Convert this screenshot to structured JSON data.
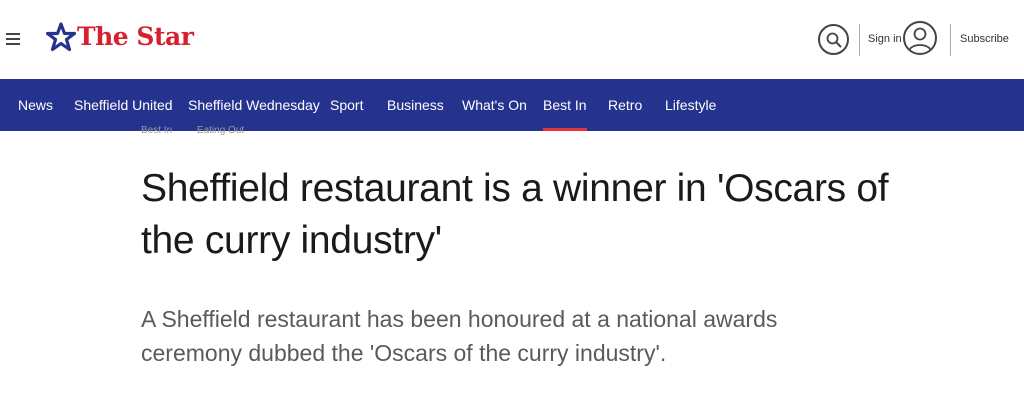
{
  "header": {
    "brand": "The Star",
    "signin_label": "Sign in",
    "subscribe_label": "Subscribe"
  },
  "nav": {
    "items": [
      {
        "label": "News"
      },
      {
        "label": "Sheffield United"
      },
      {
        "label": "Sheffield Wednesday"
      },
      {
        "label": "Sport"
      },
      {
        "label": "Business"
      },
      {
        "label": "What's On"
      },
      {
        "label": "Best In",
        "active": true
      },
      {
        "label": "Retro"
      },
      {
        "label": "Lifestyle"
      }
    ]
  },
  "breadcrumb": {
    "items": [
      "Best In",
      "Eating Out"
    ]
  },
  "article": {
    "headline": "Sheffield restaurant is a winner in 'Oscars of the curry industry'",
    "standfirst": "A Sheffield restaurant has been honoured at a national awards ceremony dubbed the 'Oscars of the curry industry'."
  },
  "colors": {
    "brand_red": "#d6202b",
    "brand_blue": "#26338e",
    "active_underline": "#e23340"
  },
  "icons": {
    "menu": "hamburger-menu-icon",
    "logo": "star-logo-icon",
    "search": "search-icon",
    "account": "user-account-icon"
  }
}
